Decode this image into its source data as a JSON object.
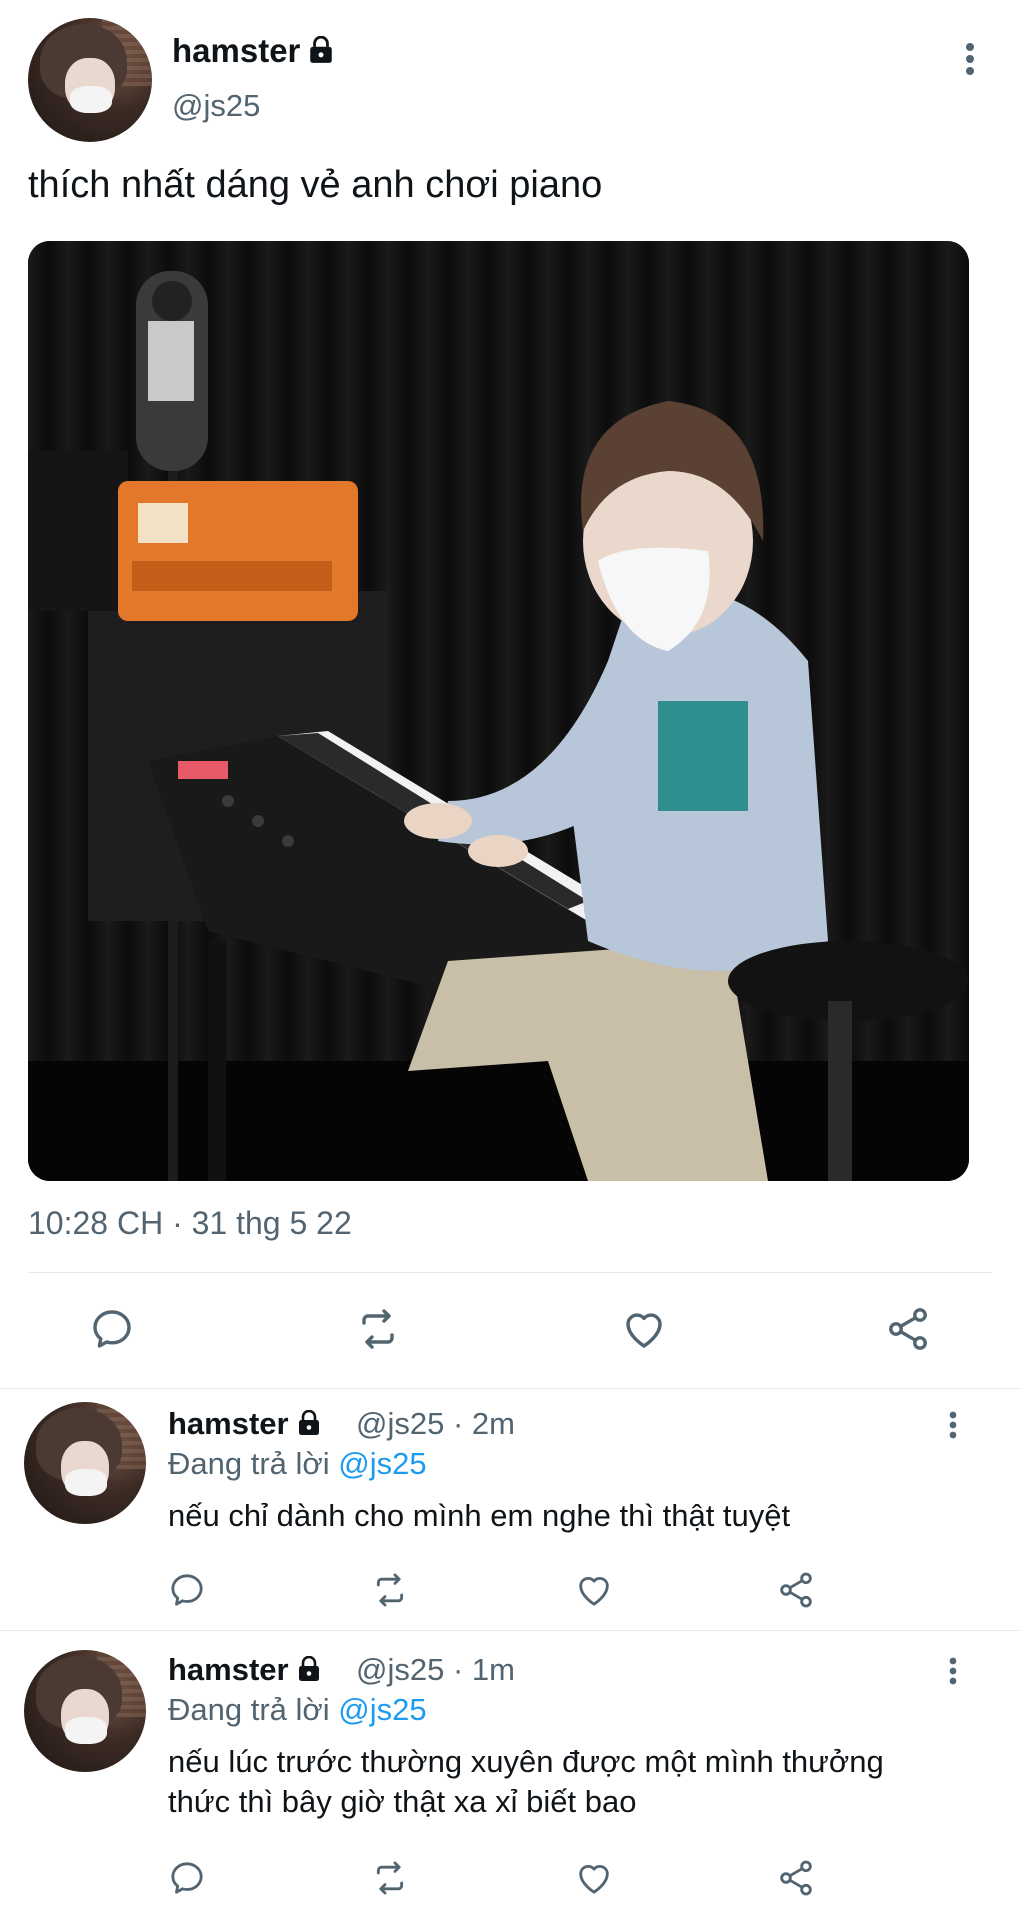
{
  "main_tweet": {
    "author_name": "hamster",
    "author_handle": "@js25",
    "text": "thích nhất dáng vẻ anh chơi piano",
    "timestamp": "10:28 CH · 31 thg 5 22",
    "media_description": "",
    "actions": [
      "reply-icon",
      "retweet-icon",
      "like-icon",
      "share-icon"
    ]
  },
  "replies": [
    {
      "author_name": "hamster",
      "author_handle": "@js25",
      "time": "· 2m",
      "replying_prefix": "Đang trả lời",
      "replying_to": "@js25",
      "text_lines": [
        "nếu chỉ dành cho mình em nghe thì thật tuyệt"
      ]
    },
    {
      "author_name": "hamster",
      "author_handle": "@js25",
      "time": "· 1m",
      "replying_prefix": "Đang trả lời",
      "replying_to": "@js25",
      "text_lines": [
        "nếu lúc trước thường xuyên được một mình thưởng",
        "thức thì bây giờ thật xa xỉ biết bao"
      ]
    }
  ],
  "colors": {
    "text_primary": "#0f1419",
    "text_secondary": "#536471",
    "link": "#1d9bf0",
    "divider": "#e6e9eb",
    "icon": "#536471"
  }
}
